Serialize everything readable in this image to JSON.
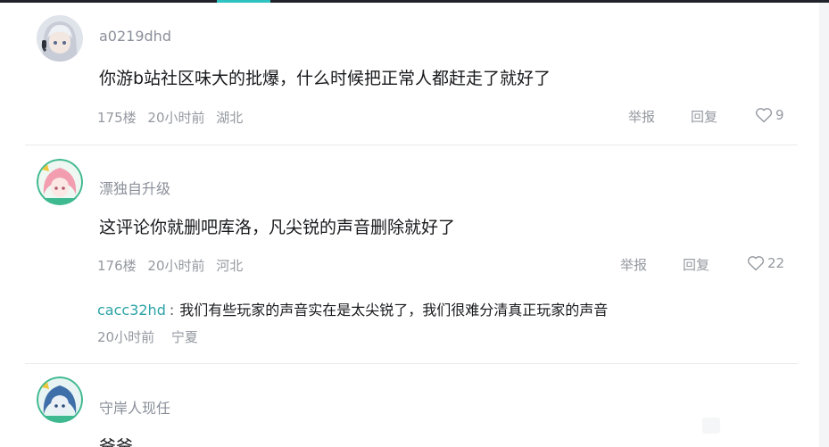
{
  "comments": [
    {
      "username": "a0219dhd",
      "content": "你游b站社区味大的批爆，什么时候把正常人都赶走了就好了",
      "floor": "175楼",
      "time": "20小时前",
      "location": "湖北",
      "report_label": "举报",
      "reply_label": "回复",
      "likes": "9"
    },
    {
      "username": "漂独自升级",
      "content": "这评论你就删吧库洛，凡尖锐的声音删除就好了",
      "floor": "176楼",
      "time": "20小时前",
      "location": "河北",
      "report_label": "举报",
      "reply_label": "回复",
      "likes": "22",
      "reply": {
        "user": "cacc32hd",
        "separator": ":",
        "text": "我们有些玩家的声音实在是太尖锐了，我们很难分清真正玩家的声音",
        "time": "20小时前",
        "location": "宁夏"
      }
    },
    {
      "username": "守岸人现任",
      "content": "爸爸"
    }
  ],
  "colors": {
    "accent": "#2ec2c0",
    "reply_user": "#2ba3a7",
    "meta": "#9499a0"
  },
  "icons": {
    "like": "heart-outline-icon"
  }
}
